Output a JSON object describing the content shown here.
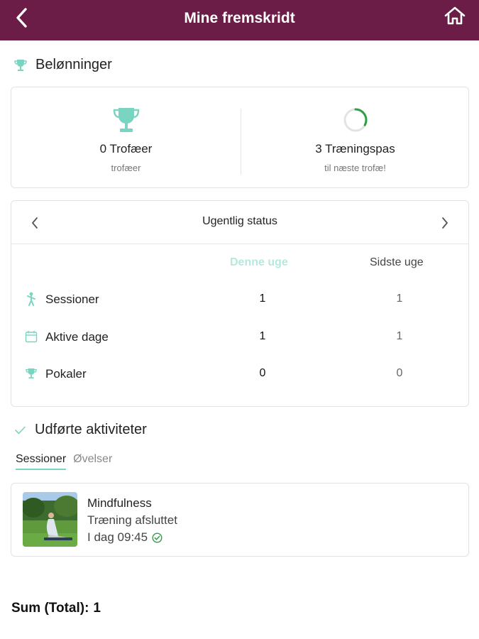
{
  "header": {
    "title": "Mine fremskridt",
    "back_icon": "chevron-left-icon",
    "home_icon": "home-icon",
    "background": "#6b1d47"
  },
  "rewards": {
    "section_title": "Belønninger",
    "trophies": {
      "value": "0 Trofæer",
      "caption": "trofæer",
      "icon": "trophy-icon"
    },
    "sessions_to_next": {
      "value": "3 Træningspas",
      "caption": "til næste trofæ!",
      "icon": "progress-ring-icon",
      "progress_fraction": 0.33
    }
  },
  "weekly_status": {
    "title": "Ugentlig status",
    "columns": {
      "this_week": "Denne uge",
      "last_week": "Sidste uge"
    },
    "rows": [
      {
        "label": "Sessioner",
        "this_week": "1",
        "last_week": "1",
        "icon": "person-icon"
      },
      {
        "label": "Aktive dage",
        "this_week": "1",
        "last_week": "1",
        "icon": "calendar-icon"
      },
      {
        "label": "Pokaler",
        "this_week": "0",
        "last_week": "0",
        "icon": "trophy-icon"
      }
    ]
  },
  "completed": {
    "section_title": "Udførte aktiviteter",
    "tabs": [
      "Sessioner",
      "Øvelser"
    ],
    "active_tab": "Sessioner",
    "items": [
      {
        "title": "Mindfulness",
        "status": "Træning afsluttet",
        "time": "I dag 09:45",
        "status_icon": "check-circle-icon"
      }
    ]
  },
  "total": {
    "label": "Sum (Total):",
    "value": "1"
  },
  "colors": {
    "accent": "#7ad4c2",
    "accent_light": "#b5e8de",
    "brand": "#6b1d47",
    "success": "#2ea043"
  }
}
